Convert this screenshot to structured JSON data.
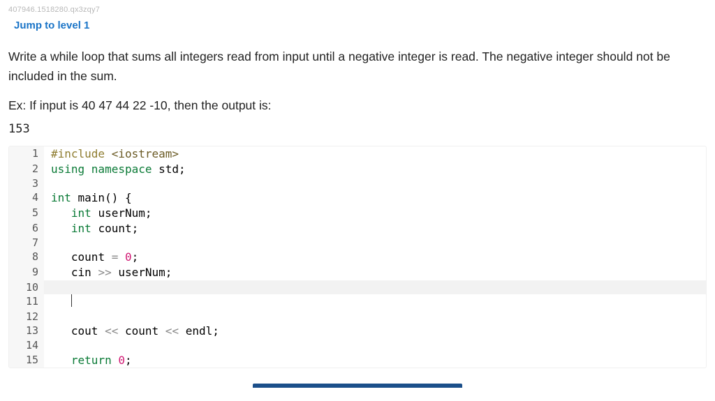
{
  "sku": "407946.1518280.qx3zqy7",
  "jump_label": "Jump to level 1",
  "problem_text": "Write a while loop that sums all integers read from input until a negative integer is read. The negative integer should not be included in the sum.",
  "example_prefix": "Ex: If input is ",
  "example_input": "40 47 44 22 -10",
  "example_suffix": ", then the output is:",
  "example_output": "153",
  "code": {
    "l1": {
      "n": "1",
      "t_prep": "#include ",
      "t_hdr": "<iostream>"
    },
    "l2": {
      "n": "2",
      "t_kw1": "using ",
      "t_kw2": "namespace ",
      "t_id": "std",
      "t_punc": ";"
    },
    "l3": {
      "n": "3",
      "t": ""
    },
    "l4": {
      "n": "4",
      "t_kw": "int ",
      "t_id": "main",
      "t_par": "() {",
      "indent": ""
    },
    "l5": {
      "n": "5",
      "indent": "   ",
      "t_kw": "int ",
      "t_id": "userNum",
      "t_punc": ";"
    },
    "l6": {
      "n": "6",
      "indent": "   ",
      "t_kw": "int ",
      "t_id": "count",
      "t_punc": ";"
    },
    "l7": {
      "n": "7",
      "t": ""
    },
    "l8": {
      "n": "8",
      "indent": "   ",
      "t_id": "count ",
      "t_op": "= ",
      "t_lit": "0",
      "t_punc": ";"
    },
    "l9": {
      "n": "9",
      "indent": "   ",
      "t_id": "cin ",
      "t_op": ">> ",
      "t_id2": "userNum",
      "t_punc": ";"
    },
    "l10": {
      "n": "10",
      "t": ""
    },
    "l11": {
      "n": "11",
      "indent": "   "
    },
    "l12": {
      "n": "12",
      "t": ""
    },
    "l13": {
      "n": "13",
      "indent": "   ",
      "t_id": "cout ",
      "t_op": "<< ",
      "t_id2": "count ",
      "t_op2": "<< ",
      "t_id3": "endl",
      "t_punc": ";"
    },
    "l14": {
      "n": "14",
      "t": ""
    },
    "l15": {
      "n": "15",
      "indent": "   ",
      "t_kw": "return ",
      "t_lit": "0",
      "t_punc": ";"
    }
  }
}
